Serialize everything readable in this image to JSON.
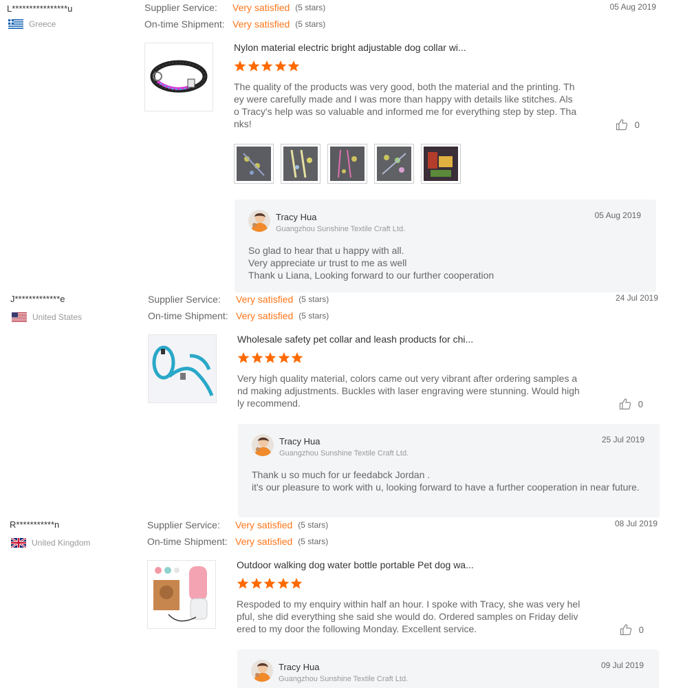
{
  "colors": {
    "accent": "#ff7519",
    "star": "#ff6a00",
    "reply_bg": "#f4f5f7"
  },
  "labels": {
    "supplier_service": "Supplier Service:",
    "ontime_shipment": "On-time Shipment:"
  },
  "reviews": [
    {
      "buyer": "L****************u",
      "country": "Greece",
      "flag_icon": "greece-flag-icon",
      "supplier_service": "Very satisfied",
      "supplier_stars": "(5 stars)",
      "ontime_shipment": "Very satisfied",
      "ontime_stars": "(5 stars)",
      "date": "05 Aug 2019",
      "product_title": "Nylon material electric bright adjustable dog collar wi...",
      "rating": 5,
      "text": "The quality of the products was very good, both the material and the printing. They were carefully made and I was more than happy with details like stitches. Also Tracy's help was so valuable and informed me for everything step by step. Thanks!",
      "likes": "0",
      "photo_count": 5,
      "reply": {
        "name": "Tracy Hua",
        "company": "Guangzhou Sunshine Textile Craft Ltd.",
        "date": "05 Aug 2019",
        "lines": [
          "So glad to hear that u happy with all.",
          "Very appreciate ur trust to me as well",
          "Thank u Liana, Looking forward to our further cooperation"
        ]
      }
    },
    {
      "buyer": "J*************e",
      "country": "United States",
      "flag_icon": "usa-flag-icon",
      "supplier_service": "Very satisfied",
      "supplier_stars": "(5 stars)",
      "ontime_shipment": "Very satisfied",
      "ontime_stars": "(5 stars)",
      "date": "24 Jul 2019",
      "product_title": "Wholesale safety pet collar and leash products for chi...",
      "rating": 5,
      "text": "Very high quality material, colors came out very vibrant after ordering samples and making adjustments. Buckles with laser engraving were stunning. Would highly recommend.",
      "likes": "0",
      "reply": {
        "name": "Tracy Hua",
        "company": "Guangzhou Sunshine Textile Craft Ltd.",
        "date": "25 Jul 2019",
        "lines": [
          "Thank u so much for ur feedabck Jordan .",
          "it's our pleasure to work with u, looking forward to have a further cooperation in near future."
        ]
      }
    },
    {
      "buyer": "R***********n",
      "country": "United Kingdom",
      "flag_icon": "uk-flag-icon",
      "supplier_service": "Very satisfied",
      "supplier_stars": "(5 stars)",
      "ontime_shipment": "Very satisfied",
      "ontime_stars": "(5 stars)",
      "date": "08 Jul 2019",
      "product_title": "Outdoor walking dog water bottle portable Pet dog wa...",
      "rating": 5,
      "text": "Respoded to my enquiry within half an hour. I spoke with Tracy, she was very helpful, she did everything she said she would do. Ordered samples on Friday delivered to my door the following Monday. Excellent service.",
      "likes": "0",
      "reply": {
        "name": "Tracy Hua",
        "company": "Guangzhou Sunshine Textile Craft Ltd.",
        "date": "09 Jul 2019"
      }
    }
  ]
}
